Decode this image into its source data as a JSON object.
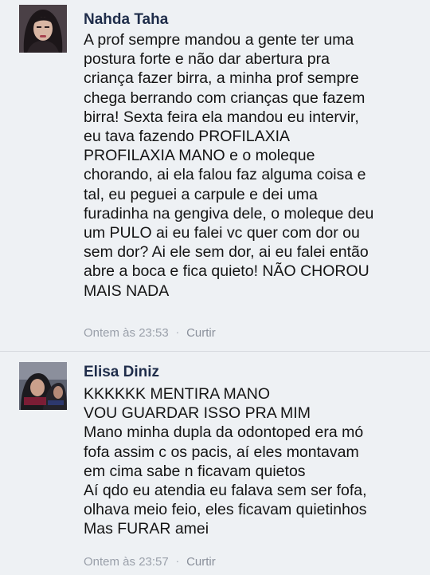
{
  "comments": [
    {
      "author": "Nahda Taha",
      "lines": [
        "A prof sempre mandou a gente ter uma",
        "postura forte e não dar abertura pra",
        "criança fazer birra, a minha prof sempre",
        "chega berrando com crianças que fazem",
        "birra! Sexta feira ela mandou eu intervir,",
        "eu tava fazendo PROFILAXIA",
        "PROFILAXIA MANO e o moleque",
        "chorando, ai ela falou faz alguma coisa e",
        "tal, eu peguei a carpule e dei uma",
        "furadinha na gengiva dele, o moleque deu",
        "um PULO ai eu falei vc quer com dor ou",
        "sem dor? Ai ele sem dor, ai eu falei então",
        "abre a boca e fica quieto! NÃO CHOROU",
        "MAIS NADA"
      ],
      "time": "Ontem às 23:53",
      "separator": "·",
      "like_label": "Curtir"
    },
    {
      "author": "Elisa Diniz",
      "lines": [
        "KKKKKK MENTIRA MANO",
        "VOU GUARDAR ISSO PRA MIM",
        "Mano minha dupla da odontoped era mó",
        "fofa assim c os pacis, aí eles montavam",
        "em cima sabe n ficavam quietos",
        "Aí qdo eu atendia eu falava sem ser fofa,",
        "olhava meio feio, eles ficavam quietinhos",
        "Mas FURAR amei"
      ],
      "time": "Ontem às 23:57",
      "separator": "·",
      "like_label": "Curtir"
    }
  ]
}
